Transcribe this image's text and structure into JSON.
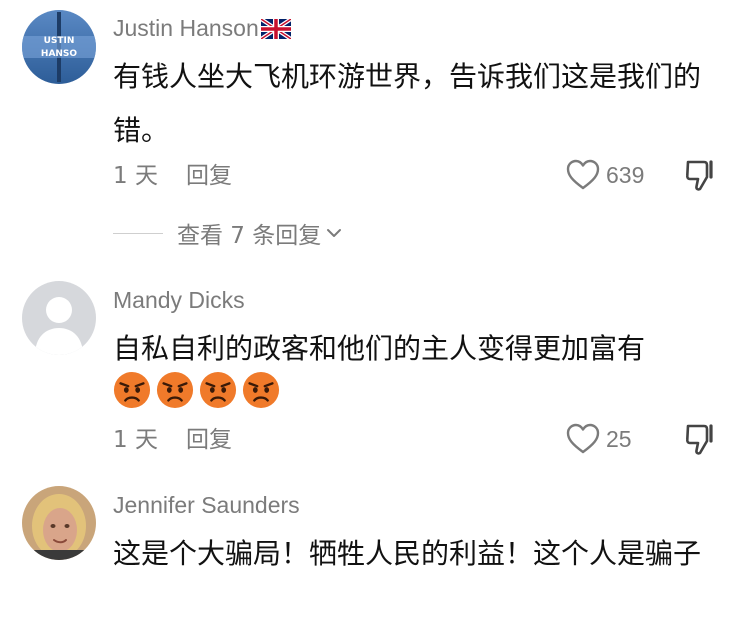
{
  "comments": [
    {
      "username": "Justin Hanson",
      "flag": "uk-flag",
      "text": "有钱人坐大飞机环游世界，告诉我们这是我们的错。",
      "time": "1 天",
      "reply_label": "回复",
      "likes": "639",
      "view_replies": "查看 7 条回复"
    },
    {
      "username": "Mandy Dicks",
      "text": "自私自利的政客和他们的主人变得更加富有",
      "emojis": [
        "angry-face-emoji",
        "angry-face-emoji",
        "angry-face-emoji",
        "angry-face-emoji"
      ],
      "time": "1 天",
      "reply_label": "回复",
      "likes": "25"
    },
    {
      "username": "Jennifer Saunders",
      "text": "这是个大骗局！牺牲人民的利益！这个人是骗子"
    }
  ],
  "avatar_1_text": "JUSTIN HANSON",
  "colors": {
    "meta_gray": "#7b7b7b",
    "text_black": "#111111",
    "emoji_orange": "#f07a2a"
  },
  "icons": [
    "heart-outline-icon",
    "dislike-icon",
    "chevron-down-icon"
  ]
}
